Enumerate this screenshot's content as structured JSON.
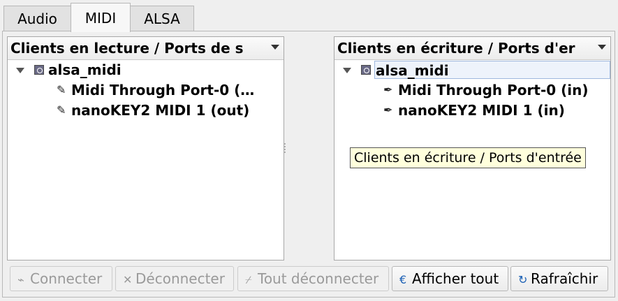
{
  "tabs": [
    {
      "label": "Audio",
      "active": false
    },
    {
      "label": "MIDI",
      "active": true
    },
    {
      "label": "ALSA",
      "active": false
    }
  ],
  "readable_panel": {
    "header": "Clients en lecture / Ports de s",
    "client": {
      "name": "alsa_midi",
      "icon": "client-icon"
    },
    "ports": [
      {
        "name": "Midi Through Port-0 (…",
        "icon": "plug-out-icon"
      },
      {
        "name": "nanoKEY2 MIDI 1 (out)",
        "icon": "plug-out-icon"
      }
    ]
  },
  "writable_panel": {
    "header": "Clients en écriture / Ports d'er",
    "client": {
      "name": "alsa_midi",
      "icon": "client-icon"
    },
    "ports": [
      {
        "name": "Midi Through Port-0 (in)",
        "icon": "plug-in-icon"
      },
      {
        "name": "nanoKEY2 MIDI 1 (in)",
        "icon": "plug-in-icon"
      }
    ]
  },
  "tooltip": "Clients en écriture / Ports d'entrée",
  "buttons": {
    "connect": {
      "label": "Connecter",
      "mnemonic": "C",
      "enabled": false
    },
    "disconnect": {
      "label": "Déconnecter",
      "mnemonic": "D",
      "enabled": false
    },
    "disconnect_all": {
      "label": "Tout déconnecter",
      "mnemonic": "T",
      "enabled": false
    },
    "show_all": {
      "label": "Afficher tout",
      "mnemonic": "A",
      "enabled": true
    },
    "refresh": {
      "label": "Rafraîchir",
      "mnemonic": "R",
      "enabled": true
    }
  },
  "colors": {
    "selection_bg": "#eef3fb",
    "tooltip_bg": "#ffffdc",
    "show_all_icon": "#1a5fb4",
    "refresh_icon": "#1a5fb4"
  }
}
